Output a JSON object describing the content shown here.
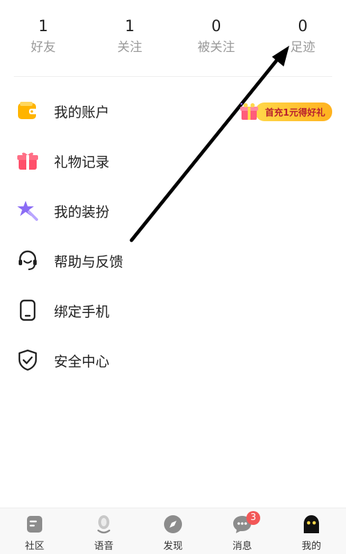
{
  "stats": [
    {
      "count": "1",
      "label": "好友"
    },
    {
      "count": "1",
      "label": "关注"
    },
    {
      "count": "0",
      "label": "被关注"
    },
    {
      "count": "0",
      "label": "足迹"
    }
  ],
  "menu": [
    {
      "label": "我的账户",
      "icon": "wallet-icon",
      "color": "#ffb400"
    },
    {
      "label": "礼物记录",
      "icon": "gift-icon",
      "color": "#ff4f6a"
    },
    {
      "label": "我的装扮",
      "icon": "star-wand-icon",
      "color": "#8b6cf5"
    },
    {
      "label": "帮助与反馈",
      "icon": "headset-icon",
      "color": "#222222"
    },
    {
      "label": "绑定手机",
      "icon": "phone-icon",
      "color": "#222222"
    },
    {
      "label": "安全中心",
      "icon": "shield-icon",
      "color": "#222222"
    }
  ],
  "promo": {
    "text": "首充1元得好礼",
    "icon": "gift-box-icon"
  },
  "tabs": [
    {
      "label": "社区",
      "icon": "community-icon"
    },
    {
      "label": "语音",
      "icon": "microphone-icon"
    },
    {
      "label": "发现",
      "icon": "compass-icon"
    },
    {
      "label": "消息",
      "icon": "chat-icon",
      "badge": "3"
    },
    {
      "label": "我的",
      "icon": "avatar-icon",
      "active": true
    }
  ],
  "colors": {
    "accent": "#f25757",
    "promo": "#ffc23a",
    "muted": "#9a9a9a"
  }
}
